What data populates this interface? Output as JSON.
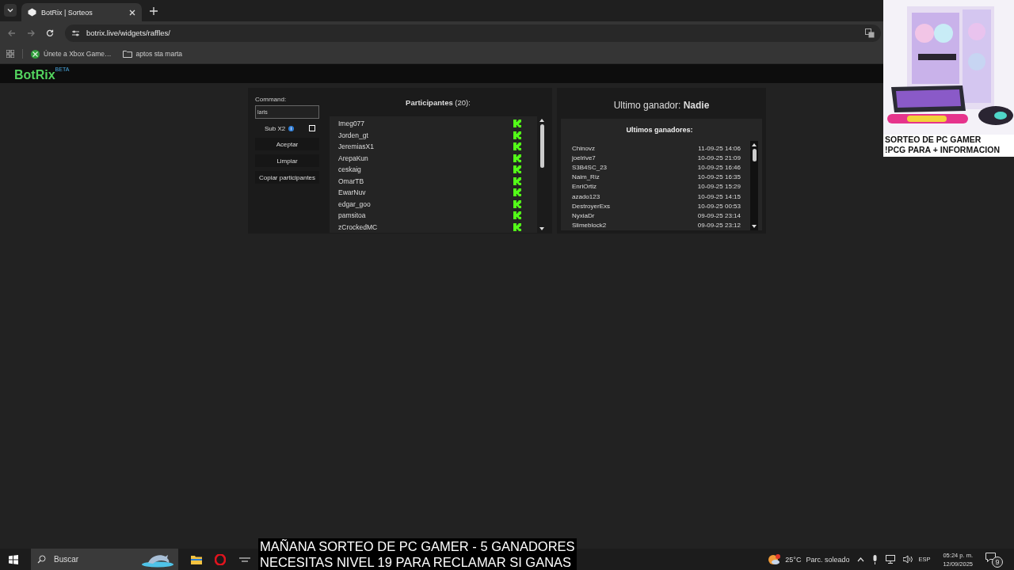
{
  "browser": {
    "tabs": [
      {
        "title": "BotRix | Sorteos",
        "selected": true
      }
    ],
    "url": "botrix.live/widgets/raffles/",
    "bookmarks": [
      {
        "label": "Únete a Xbox Game…",
        "kind": "xbox"
      },
      {
        "label": "aptos sta marta",
        "kind": "folder"
      }
    ]
  },
  "site": {
    "logo": "BotRix",
    "badge": "BETA"
  },
  "controls": {
    "command_label": "Command:",
    "command_value": "laris",
    "sub_label": "Sub X2",
    "sub_checked": false,
    "buttons": [
      "Aceptar",
      "Limpiar",
      "Copiar participantes"
    ]
  },
  "participants": {
    "title": "**Participantes** (20):",
    "names": [
      "Imeg077",
      "Jorden_gt",
      "JeremiasX1",
      "ArepaKun",
      "ceskaig",
      "OmarTB",
      "EwarNuv",
      "edgar_goo",
      "pamsitoa",
      "zCrockedMC"
    ]
  },
  "winner": {
    "title": "Ultimo ganador: **Nadie**"
  },
  "recent": {
    "title": "Ultimos ganadores:",
    "rows": [
      {
        "name": "Chinovz",
        "date": "11-09-25 14:06"
      },
      {
        "name": "joelrive7",
        "date": "10-09-25 21:09"
      },
      {
        "name": "S3B4SC_23",
        "date": "10-09-25 16:46"
      },
      {
        "name": "Naim_Riz",
        "date": "10-09-25 16:35"
      },
      {
        "name": "EnriOrtiz",
        "date": "10-09-25 15:29"
      },
      {
        "name": "azado123",
        "date": "10-09-25 14:15"
      },
      {
        "name": "DestroyerExs",
        "date": "10-09-25 00:53"
      },
      {
        "name": "NyxiaDr",
        "date": "09-09-25 23:14"
      },
      {
        "name": "Slimeblock2",
        "date": "09-09-25 23:12"
      }
    ]
  },
  "promo": {
    "lines": [
      "SORTEO DE PC GAMER",
      "!PCG PARA + INFORMACION"
    ]
  },
  "caption": {
    "lines": [
      "MAÑANA SORTEO DE PC GAMER - 5 GANADORES",
      "NECESITAS NIVEL 19 PARA RECLAMAR SI GANAS"
    ]
  },
  "taskbar": {
    "search_placeholder": "Buscar",
    "temperature": "25°C",
    "weather": "Parc. soleado",
    "language": "ESP",
    "time": "05:24 p. m.",
    "date": "12/09/2025",
    "notifications": "9"
  }
}
